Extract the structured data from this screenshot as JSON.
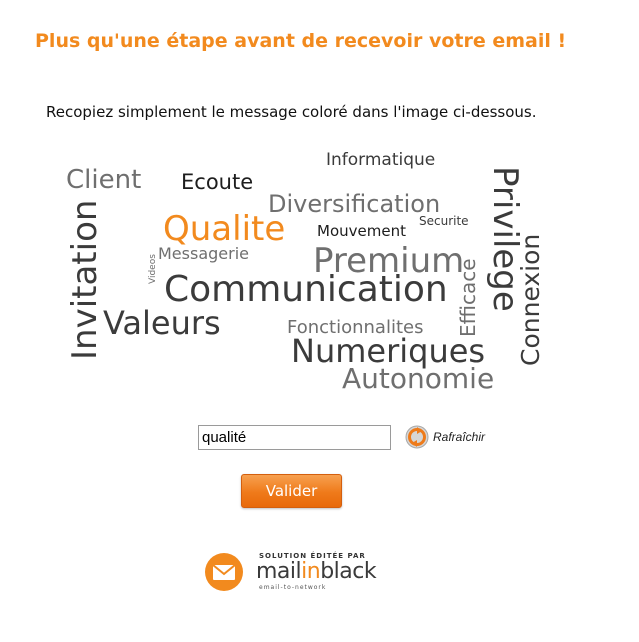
{
  "header": {
    "title": "Plus qu'une étape avant de recevoir votre email !"
  },
  "instruction": "Recopiez simplement le message coloré dans l'image ci-dessous.",
  "captcha": {
    "words": {
      "client": "Client",
      "informatique": "Informatique",
      "ecoute": "Ecoute",
      "privilege": "Privilege",
      "diversification": "Diversification",
      "securite": "Securite",
      "qualite": "Qualite",
      "mouvement": "Mouvement",
      "invitation": "Invitation",
      "videos": "Videos",
      "messagerie": "Messagerie",
      "premium": "Premium",
      "efficace": "Efficace",
      "connexion": "Connexion",
      "communication": "Communication",
      "valeurs": "Valeurs",
      "fonctionnalites": "Fonctionnalites",
      "numeriques": "Numeriques",
      "autonomie": "Autonomie"
    },
    "highlight_color": "#f28a1e",
    "input_value": "qualité",
    "refresh_label": "Rafraîchir",
    "refresh_icon": "refresh-icon"
  },
  "actions": {
    "submit_label": "Valider"
  },
  "branding": {
    "tagline": "SOLUTION ÉDITÉE PAR",
    "brand_part1": "mail",
    "brand_part2": "in",
    "brand_part3": "black",
    "sub": "email-to-network",
    "icon": "envelope-icon",
    "brand_color": "#f28a1e"
  }
}
